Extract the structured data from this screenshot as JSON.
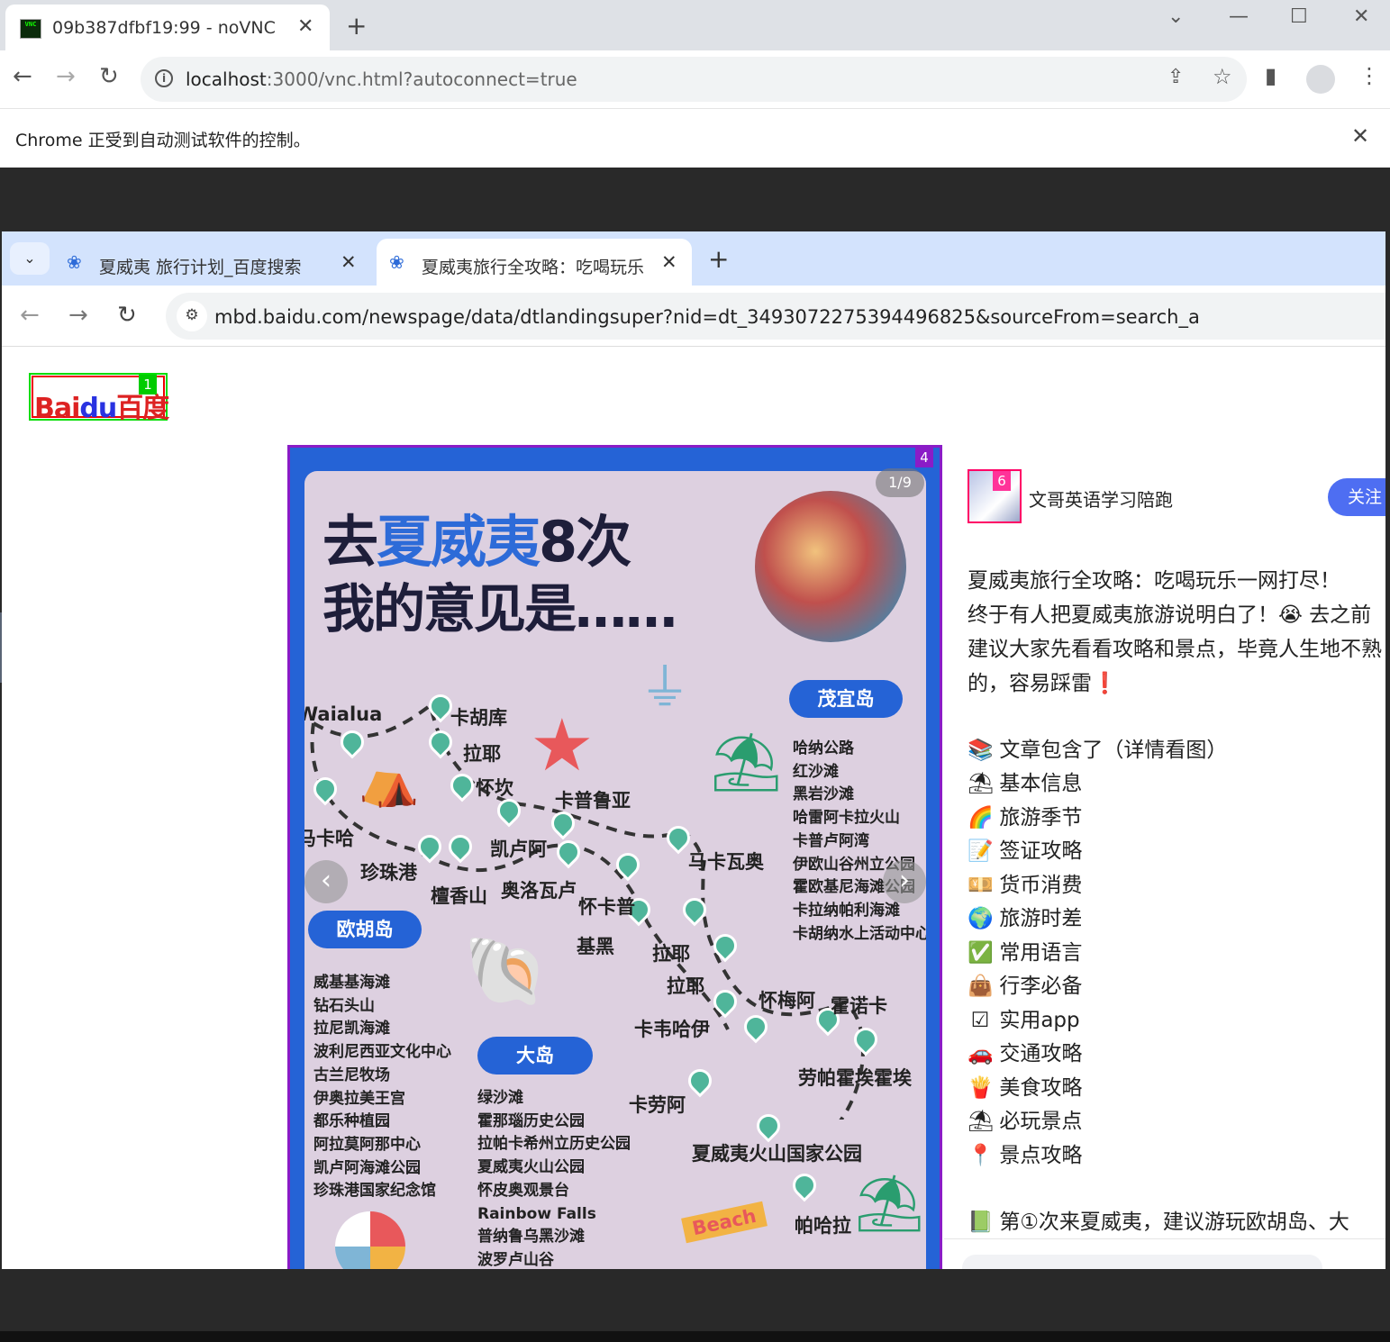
{
  "outer_browser": {
    "tab_title": "09b387dfbf19:99 - noVNC",
    "favicon_text": "VNC",
    "url_host": "localhost",
    "url_rest": ":3000/vnc.html?autoconnect=true",
    "infobar_message": "Chrome 正受到自动测试软件的控制。"
  },
  "inner_browser": {
    "tabs": [
      {
        "title": "夏威夷 旅行计划_百度搜索"
      },
      {
        "title": "夏威夷旅行全攻略：吃喝玩乐"
      }
    ],
    "url": "mbd.baidu.com/newspage/data/dtlandingsuper?nid=dt_3493072275394496825&sourceFrom=search_a"
  },
  "page": {
    "logo": {
      "text_red": "Bai",
      "text_blue": "du",
      "text_cn": "百度"
    },
    "markers": {
      "logo": "1",
      "image": "4",
      "avatar": "6"
    },
    "carousel": {
      "counter": "1/9",
      "prev": "‹",
      "next": "›"
    },
    "poster": {
      "title_prefix": "去",
      "title_highlight": "夏威夷",
      "title_suffix": "8次",
      "subtitle": "我的意见是……",
      "islands": [
        "茂宜岛",
        "欧胡岛",
        "大岛"
      ],
      "places": [
        "Waialua",
        "卡胡库",
        "拉耶",
        "怀坎",
        "卡普鲁亚",
        "马卡哈",
        "凯卢阿",
        "马卡瓦奥",
        "珍珠港",
        "檀香山",
        "奥洛瓦卢",
        "怀卡普",
        "基黑",
        "拉耶",
        "拉耶",
        "怀梅阿",
        "霍诺卡",
        "卡韦哈伊",
        "劳帕霍埃霍埃",
        "卡劳阿",
        "夏威夷火山国家公园",
        "帕哈拉",
        "Beach"
      ],
      "maui_list": "哈纳公路\n红沙滩\n黑岩沙滩\n哈雷阿卡拉火山\n卡普卢阿湾\n伊欧山谷州立公园\n霍欧基尼海滩公园\n卡拉纳帕利海滩\n卡胡纳水上活动中心",
      "oahu_list": "威基基海滩\n钻石头山\n拉尼凯海滩\n波利尼西亚文化中心\n古兰尼牧场\n伊奥拉美王宫\n都乐种植园\n阿拉莫阿那中心\n凯卢阿海滩公园\n珍珠港国家纪念馆",
      "big_island_list": "绿沙滩\n霍那瑙历史公园\n拉帕卡希州立历史公园\n夏威夷火山公园\n怀皮奥观景台\nRainbow Falls\n普纳鲁乌黑沙滩\n波罗卢山谷"
    },
    "author": {
      "name": "文哥英语学习陪跑",
      "follow_label": "关注"
    },
    "article": {
      "lines": [
        "夏威夷旅行全攻略：吃喝玩乐一网打尽！",
        "终于有人把夏威夷旅游说明白了！😭 去之前",
        "建议大家先看看攻略和景点，毕竟人生地不熟",
        "的，容易踩雷❗"
      ],
      "toc": [
        {
          "icon": "📚",
          "text": "文章包含了（详情看图）"
        },
        {
          "icon": "⛱",
          "text": "基本信息"
        },
        {
          "icon": "🌈",
          "text": "旅游季节"
        },
        {
          "icon": "📝",
          "text": "签证攻略"
        },
        {
          "icon": "💴",
          "text": "货币消费"
        },
        {
          "icon": "🌍",
          "text": "旅游时差"
        },
        {
          "icon": "✅",
          "text": "常用语言"
        },
        {
          "icon": "👜",
          "text": "行李必备"
        },
        {
          "icon": "☑",
          "text": "实用app"
        },
        {
          "icon": "🚗",
          "text": "交通攻略"
        },
        {
          "icon": "🍟",
          "text": "美食攻略"
        },
        {
          "icon": "⛱",
          "text": "必玩景点"
        },
        {
          "icon": "📍",
          "text": "景点攻略"
        }
      ],
      "footer_line": {
        "icon": "📗",
        "text": "第①次来夏威夷，建议游玩欧胡岛、大"
      }
    }
  },
  "colors": {
    "accent": "#4e6ef2",
    "poster_blue": "#2563d6",
    "marker_green": "#00cc00",
    "marker_purple": "#8a1cc7",
    "marker_pink": "#ff3399"
  }
}
